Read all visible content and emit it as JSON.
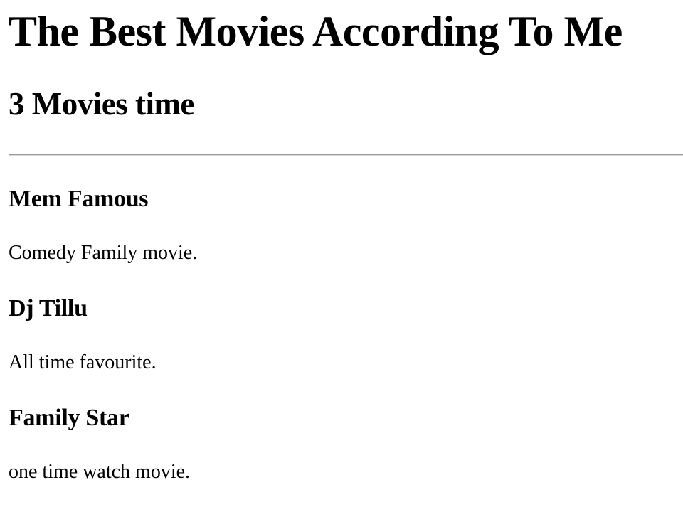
{
  "page": {
    "title": "The Best Movies According To Me",
    "subtitle": "3 Movies time"
  },
  "movies": [
    {
      "name": "Mem Famous",
      "description": "Comedy Family movie."
    },
    {
      "name": "Dj Tillu",
      "description": "All time favourite."
    },
    {
      "name": "Family Star",
      "description": "one time watch movie."
    }
  ]
}
